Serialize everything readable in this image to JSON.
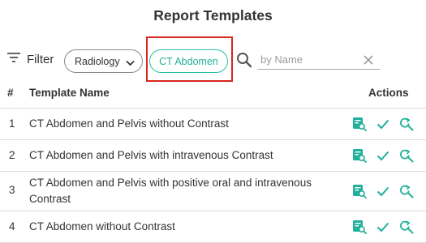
{
  "title": "Report Templates",
  "filter": {
    "label": "Filter",
    "specialty_value": "Radiology",
    "active_chip": "CT Abdomen",
    "search_placeholder": "by Name",
    "search_value": ""
  },
  "table": {
    "headers": {
      "number": "#",
      "name": "Template Name",
      "actions": "Actions"
    },
    "rows": [
      {
        "number": "1",
        "name": "CT Abdomen and Pelvis without Contrast"
      },
      {
        "number": "2",
        "name": "CT Abdomen and Pelvis with intravenous Contrast"
      },
      {
        "number": "3",
        "name": "CT Abdomen and Pelvis with positive oral and intravenous Contrast"
      },
      {
        "number": "4",
        "name": "CT Abdomen without Contrast"
      }
    ]
  },
  "icons": {
    "filter": "filter-lines-icon",
    "chevron": "chevron-down-icon",
    "search": "search-icon",
    "clear": "close-icon",
    "preview": "preview-report-icon",
    "select": "check-icon",
    "find_replace": "find-replace-icon"
  },
  "colors": {
    "accent": "#21b09a",
    "highlight": "#d9271d"
  }
}
